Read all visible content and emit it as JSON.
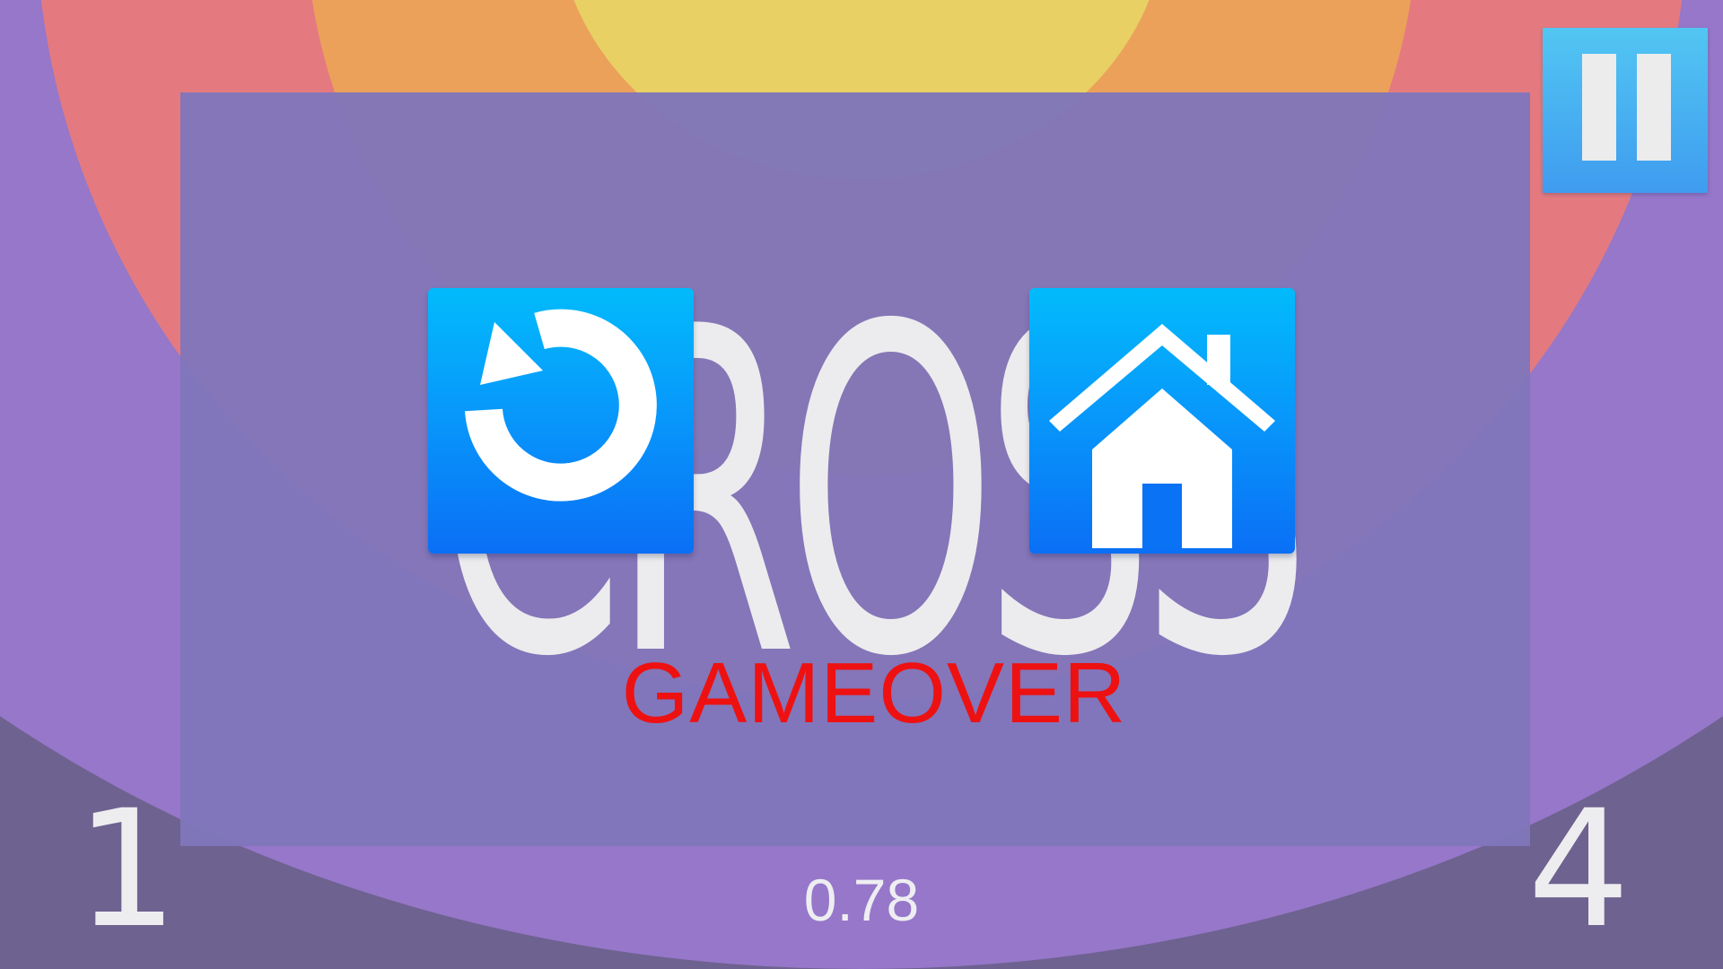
{
  "game": {
    "background_word": "CROSS",
    "status_text": "GAMEOVER",
    "score_left": "1",
    "score_right": "4",
    "timer": "0.78"
  },
  "buttons": {
    "restart_icon": "restart-icon",
    "home_icon": "home-icon",
    "pause_icon": "pause-icon"
  },
  "colors": {
    "background_purple": "#9677c9",
    "ring_red": "#e47a7f",
    "ring_orange": "#eba15a",
    "ring_yellow": "#e8d064",
    "panel": "#8076ba",
    "button_blue": "#0896fb",
    "status_red": "#ee1111",
    "text_light": "#ececee"
  }
}
